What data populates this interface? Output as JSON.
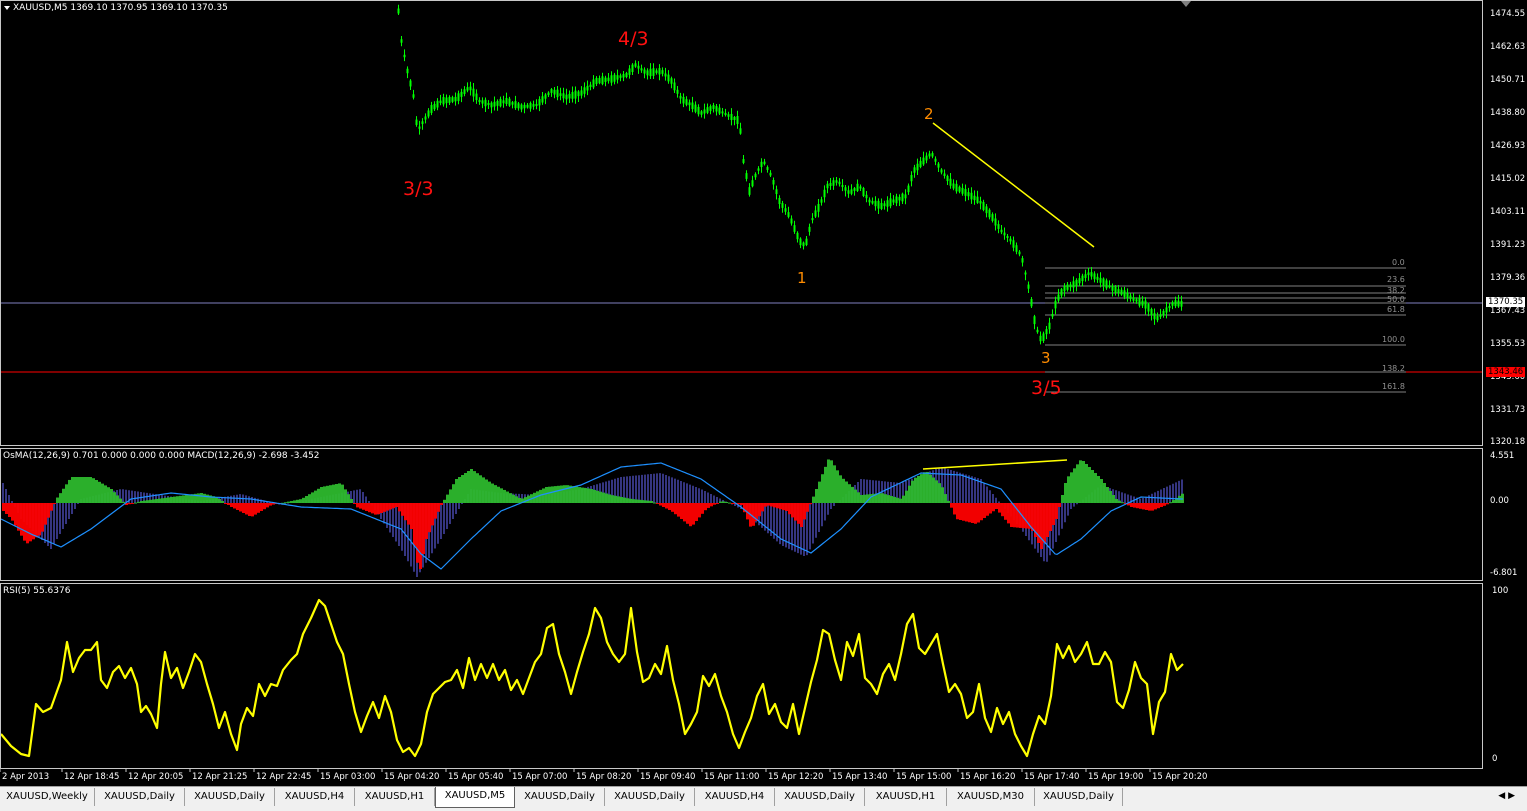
{
  "symbol_title": "XAUUSD,M5  1369.10 1370.95 1369.10 1370.35",
  "price_axis": {
    "ticks": [
      "1474.55",
      "1462.63",
      "1450.71",
      "1438.80",
      "1426.93",
      "1415.02",
      "1403.11",
      "1391.23",
      "1379.36",
      "1367.43",
      "1355.53",
      "1343.60",
      "1331.73",
      "1320.18"
    ],
    "current_price": "1370.35",
    "red_level_price": "1343.46"
  },
  "wave_labels": {
    "w43": "4/3",
    "w33": "3/3",
    "w35": "3/5",
    "w1": "1",
    "w2": "2",
    "w3": "3"
  },
  "fib_levels": [
    "0.0",
    "23.6",
    "38.2",
    "50.0",
    "61.8",
    "100.0",
    "138.2",
    "161.8"
  ],
  "osma": {
    "label": "OsMA(12,26,9) 0.701 0.000 0.000 0.000  MACD(12,26,9) -2.698 -3.452",
    "axis_ticks": [
      "4.551",
      "0.00",
      "-6.801"
    ]
  },
  "rsi": {
    "label": "RSI(5) 55.6376",
    "axis_ticks": [
      "100",
      "0"
    ]
  },
  "time_axis": [
    "2 Apr 2013",
    "12 Apr 18:45",
    "12 Apr 20:05",
    "12 Apr 21:25",
    "12 Apr 22:45",
    "15 Apr 03:00",
    "15 Apr 04:20",
    "15 Apr 05:40",
    "15 Apr 07:00",
    "15 Apr 08:20",
    "15 Apr 09:40",
    "15 Apr 11:00",
    "15 Apr 12:20",
    "15 Apr 13:40",
    "15 Apr 15:00",
    "15 Apr 16:20",
    "15 Apr 17:40",
    "15 Apr 19:00",
    "15 Apr 20:20"
  ],
  "tabs": [
    {
      "label": "XAUUSD,Weekly",
      "active": false
    },
    {
      "label": "XAUUSD,Daily",
      "active": false
    },
    {
      "label": "XAUUSD,Daily",
      "active": false
    },
    {
      "label": "XAUUSD,H4",
      "active": false
    },
    {
      "label": "XAUUSD,H1",
      "active": false
    },
    {
      "label": "XAUUSD,M5",
      "active": true
    },
    {
      "label": "XAUUSD,Daily",
      "active": false
    },
    {
      "label": "XAUUSD,Daily",
      "active": false
    },
    {
      "label": "XAUUSD,H4",
      "active": false
    },
    {
      "label": "XAUUSD,Daily",
      "active": false
    },
    {
      "label": "XAUUSD,H1",
      "active": false
    },
    {
      "label": "XAUUSD,M30",
      "active": false
    },
    {
      "label": "XAUUSD,Daily",
      "active": false
    }
  ],
  "colors": {
    "candles": "#00ff00",
    "wave_red": "#ff1010",
    "wave_orange": "#ff8c00",
    "trendline": "#ffff00",
    "macd_line": "#1e90ff",
    "osma_pos": "#2db82d",
    "osma_neg": "#ff0000",
    "rsi_line": "#ffff00",
    "current_price_line": "#8080c0",
    "red_level_line": "#ff0000"
  }
}
